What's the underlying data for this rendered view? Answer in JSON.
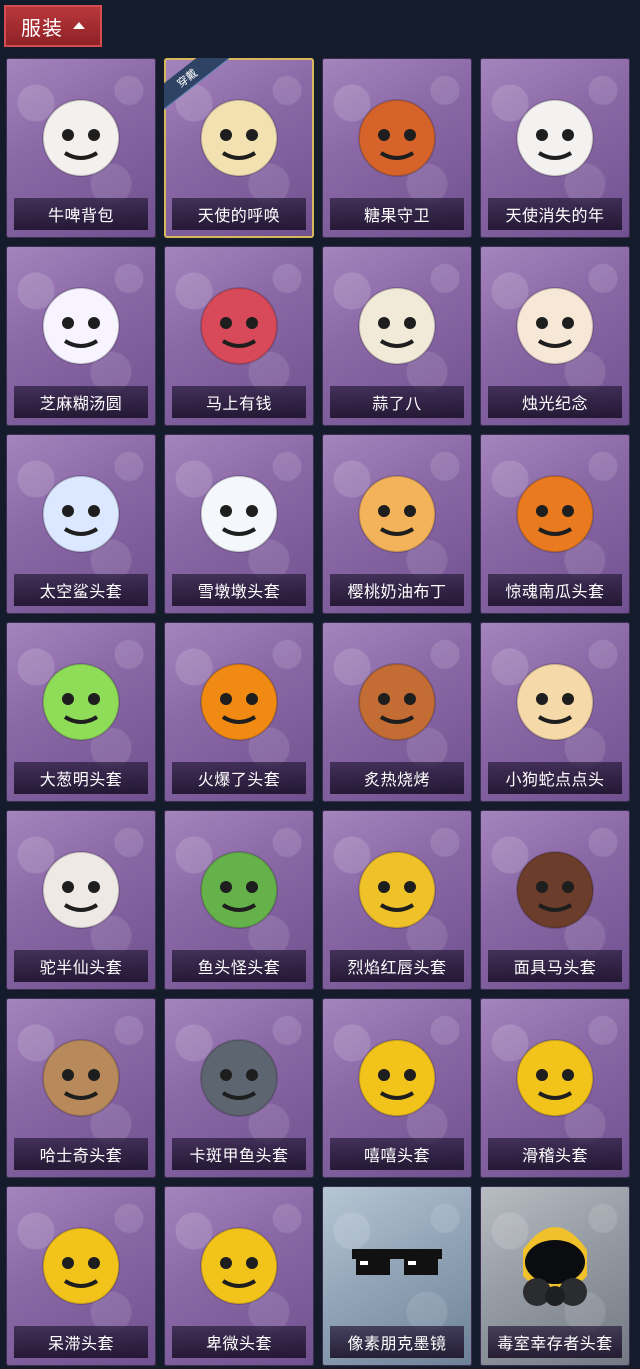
{
  "header": {
    "tab_label": "服装"
  },
  "badges": {
    "equipped": "穿戴"
  },
  "items": [
    {
      "label": "牛啤背包",
      "icon": "cow-beer-backpack-icon",
      "theme": "purple"
    },
    {
      "label": "天使的呼唤",
      "icon": "angel-doll-icon",
      "theme": "purple",
      "equipped": true
    },
    {
      "label": "糖果守卫",
      "icon": "pumpkin-guard-icon",
      "theme": "purple"
    },
    {
      "label": "天使消失的年",
      "icon": "veiled-angel-icon",
      "theme": "purple"
    },
    {
      "label": "芝麻糊汤圆",
      "icon": "dumpling-icon",
      "theme": "purple"
    },
    {
      "label": "马上有钱",
      "icon": "red-horse-icon",
      "theme": "purple"
    },
    {
      "label": "蒜了八",
      "icon": "garlic-icon",
      "theme": "purple"
    },
    {
      "label": "烛光纪念",
      "icon": "candle-icon",
      "theme": "purple"
    },
    {
      "label": "太空鲨头套",
      "icon": "space-shark-icon",
      "theme": "purple"
    },
    {
      "label": "雪墩墩头套",
      "icon": "snowman-icon",
      "theme": "purple"
    },
    {
      "label": "樱桃奶油布丁",
      "icon": "pudding-icon",
      "theme": "purple"
    },
    {
      "label": "惊魂南瓜头套",
      "icon": "jack-o-lantern-icon",
      "theme": "purple"
    },
    {
      "label": "大葱明头套",
      "icon": "scallion-icon",
      "theme": "purple"
    },
    {
      "label": "火爆了头套",
      "icon": "fire-spirit-icon",
      "theme": "purple"
    },
    {
      "label": "炙热烧烤",
      "icon": "bbq-meat-icon",
      "theme": "purple"
    },
    {
      "label": "小狗蛇点点头",
      "icon": "snake-dog-icon",
      "theme": "purple"
    },
    {
      "label": "驼半仙头套",
      "icon": "alpaca-sunglasses-icon",
      "theme": "purple"
    },
    {
      "label": "鱼头怪头套",
      "icon": "fish-head-icon",
      "theme": "purple"
    },
    {
      "label": "烈焰红唇头套",
      "icon": "lips-mask-icon",
      "theme": "purple"
    },
    {
      "label": "面具马头套",
      "icon": "horse-mask-icon",
      "theme": "purple"
    },
    {
      "label": "哈士奇头套",
      "icon": "husky-icon",
      "theme": "purple"
    },
    {
      "label": "卡斑甲鱼头套",
      "icon": "turtle-icon",
      "theme": "purple"
    },
    {
      "label": "嘻嘻头套",
      "icon": "grin-emoji-icon",
      "theme": "purple"
    },
    {
      "label": "滑稽头套",
      "icon": "smirk-emoji-icon",
      "theme": "purple"
    },
    {
      "label": "呆滞头套",
      "icon": "stare-emoji-icon",
      "theme": "purple"
    },
    {
      "label": "卑微头套",
      "icon": "shy-emoji-icon",
      "theme": "purple"
    },
    {
      "label": "像素朋克墨镜",
      "icon": "pixel-sunglasses-icon",
      "theme": "blue"
    },
    {
      "label": "毒室幸存者头套",
      "icon": "gas-mask-icon",
      "theme": "gray"
    }
  ]
}
